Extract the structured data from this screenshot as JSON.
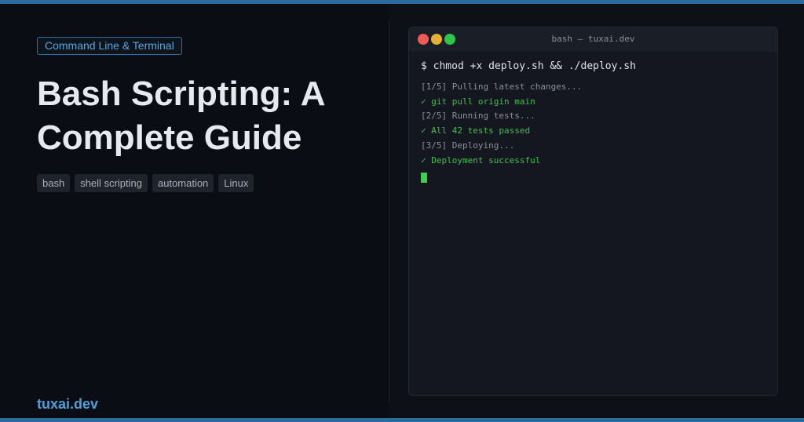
{
  "category": "Command Line & Terminal",
  "title": "Bash Scripting: A Complete Guide",
  "tags": [
    "bash",
    "shell scripting",
    "automation",
    "Linux"
  ],
  "brand": "tuxai.dev",
  "terminal": {
    "window_title": "bash — tuxai.dev",
    "command": "$ chmod +x deploy.sh && ./deploy.sh",
    "output": [
      {
        "text": "[1/5] Pulling latest changes...",
        "kind": "step"
      },
      {
        "text": "✓ git pull origin main",
        "kind": "ok"
      },
      {
        "text": "[2/5] Running tests...",
        "kind": "step"
      },
      {
        "text": "✓ All 42 tests passed",
        "kind": "ok"
      },
      {
        "text": "[3/5] Deploying...",
        "kind": "step"
      },
      {
        "text": "✓ Deployment successful",
        "kind": "ok"
      }
    ]
  },
  "colors": {
    "accent": "#2a6d9c",
    "brand": "#4f9fd9",
    "success": "#3fbf4f",
    "background": "#0b0e15"
  }
}
